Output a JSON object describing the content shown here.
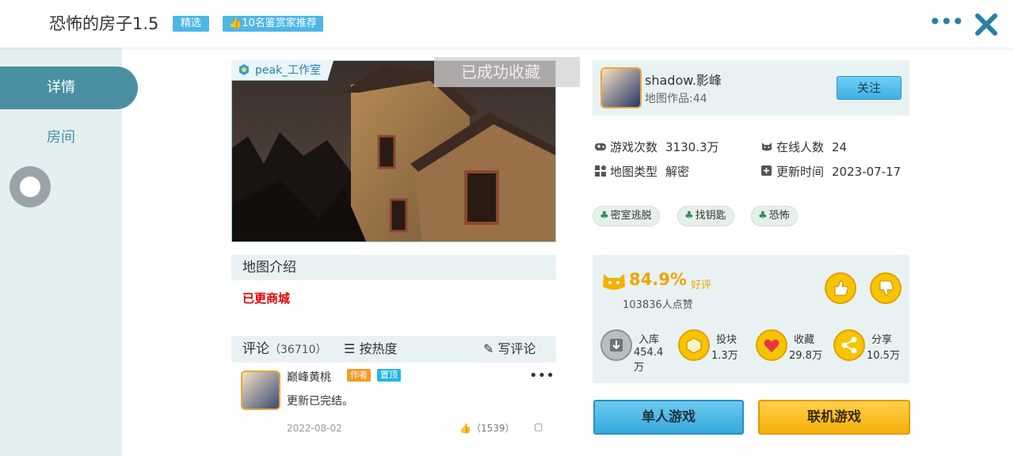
{
  "header": {
    "title": "恐怖的房子1.5",
    "badge_featured": "精选",
    "badge_recommend": "10名鉴赏家推荐",
    "more_icon": "more-icon",
    "close_icon": "close-icon"
  },
  "sidebar": {
    "items": [
      {
        "label": "详情",
        "active": true
      },
      {
        "label": "房间",
        "active": false
      }
    ]
  },
  "cover": {
    "studio": "peak_工作室",
    "toast": "已成功收藏"
  },
  "intro": {
    "title": "地图介绍",
    "text": "已更商城"
  },
  "comments": {
    "title": "评论",
    "count": "（36710）",
    "sort_label": "按热度",
    "write_label": "写评论",
    "items": [
      {
        "user": "巅峰黄桃",
        "author_badge": "作者",
        "pin_badge": "置顶",
        "text": "更新已完结。",
        "date": "2022-08-02",
        "likes": "（1539）"
      }
    ]
  },
  "author": {
    "name": "shadow.影峰",
    "works": "地图作品:44",
    "follow_label": "关注"
  },
  "stats": {
    "plays_label": "游戏次数",
    "plays_value": "3130.3万",
    "online_label": "在线人数",
    "online_value": "24",
    "type_label": "地图类型",
    "type_value": "解密",
    "updated_label": "更新时间",
    "updated_value": "2023-07-17"
  },
  "tags": [
    "密室逃脱",
    "找钥匙",
    "恐怖"
  ],
  "rating": {
    "percent": "84.9%",
    "good_label": "好评",
    "likes_text": "103836人点赞"
  },
  "actions": [
    {
      "name": "入库",
      "value": "454.4万",
      "icon": "download-icon",
      "color": "#b8bfc2"
    },
    {
      "name": "投块",
      "value": "1.3万",
      "icon": "block-icon",
      "color": "#f7c400"
    },
    {
      "name": "收藏",
      "value": "29.8万",
      "icon": "heart-icon",
      "color": "#f7c400"
    },
    {
      "name": "分享",
      "value": "10.5万",
      "icon": "share-icon",
      "color": "#f7c400"
    }
  ],
  "buttons": {
    "single": "单人游戏",
    "multi": "联机游戏"
  }
}
